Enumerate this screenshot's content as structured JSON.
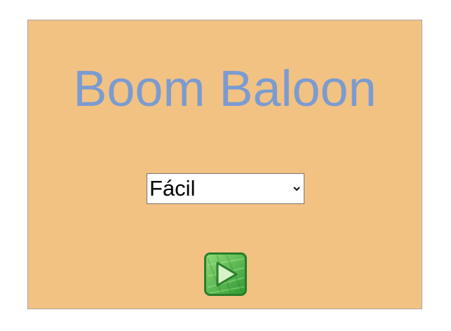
{
  "game": {
    "title": "Boom Baloon",
    "difficulty": {
      "selected": "Fácil"
    },
    "play_button": {
      "icon": "play-icon"
    }
  },
  "colors": {
    "panel_background": "#f2c283",
    "title_color": "#7b9bd1",
    "play_button_green": "#4fb847"
  }
}
